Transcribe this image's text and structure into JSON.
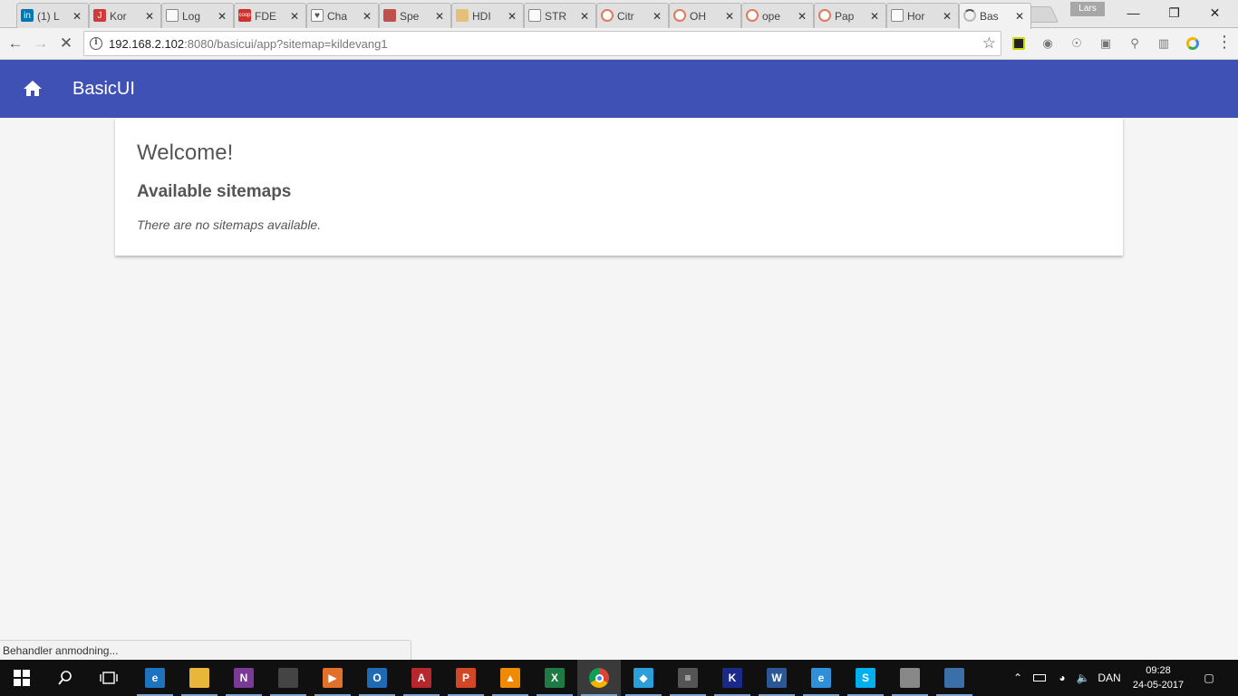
{
  "browser": {
    "tabs": [
      {
        "title": "(1) L",
        "icon": "linkedin-icon",
        "color": "#0077b5",
        "glyph": "in"
      },
      {
        "title": "Kor",
        "icon": "j-icon",
        "color": "#d03a3a",
        "glyph": "J"
      },
      {
        "title": "Log",
        "icon": "page-icon",
        "color": "",
        "glyph": ""
      },
      {
        "title": "FDE",
        "icon": "coop-icon",
        "color": "#d0312d",
        "glyph": "coop"
      },
      {
        "title": "Cha",
        "icon": "heart-icon",
        "color": "",
        "glyph": "♥"
      },
      {
        "title": "Spe",
        "icon": "gnome-icon",
        "color": "#c0504d",
        "glyph": ""
      },
      {
        "title": "HDI",
        "icon": "badge-icon",
        "color": "#e5c07b",
        "glyph": ""
      },
      {
        "title": "STR",
        "icon": "page-icon",
        "color": "",
        "glyph": ""
      },
      {
        "title": "Citr",
        "icon": "spiral-icon",
        "color": "",
        "glyph": ""
      },
      {
        "title": "OH",
        "icon": "openhab-icon",
        "color": "",
        "glyph": ""
      },
      {
        "title": "ope",
        "icon": "openhab-icon",
        "color": "",
        "glyph": ""
      },
      {
        "title": "Pap",
        "icon": "openhab-icon",
        "color": "",
        "glyph": ""
      },
      {
        "title": "Hor",
        "icon": "page-icon",
        "color": "",
        "glyph": ""
      },
      {
        "title": "Bas",
        "icon": "loading-spinner-icon",
        "color": "",
        "glyph": ""
      }
    ],
    "profile_name": "Lars",
    "url_host": "192.168.2.102",
    "url_rest": ":8080/basicui/app?sitemap=kildevang1",
    "status_text": "Behandler anmodning..."
  },
  "app": {
    "title": "BasicUI",
    "accent": "#3f51b5"
  },
  "card": {
    "welcome": "Welcome!",
    "heading": "Available sitemaps",
    "empty_message": "There are no sitemaps available."
  },
  "taskbar": {
    "apps": [
      {
        "name": "edge",
        "color": "#1e73be",
        "glyph": "e"
      },
      {
        "name": "file-explorer",
        "color": "#e8b73a",
        "glyph": ""
      },
      {
        "name": "onenote",
        "color": "#7b3a96",
        "glyph": "N"
      },
      {
        "name": "store",
        "color": "#444",
        "glyph": ""
      },
      {
        "name": "media-player",
        "color": "#e0702a",
        "glyph": "▶"
      },
      {
        "name": "outlook",
        "color": "#1e6ab3",
        "glyph": "O"
      },
      {
        "name": "access",
        "color": "#b7282e",
        "glyph": "A"
      },
      {
        "name": "powerpoint",
        "color": "#d24726",
        "glyph": "P"
      },
      {
        "name": "vlc",
        "color": "#f08a00",
        "glyph": "▲"
      },
      {
        "name": "excel",
        "color": "#1d7a44",
        "glyph": "X"
      },
      {
        "name": "chrome",
        "color": "#4285f4",
        "glyph": ""
      },
      {
        "name": "remote",
        "color": "#2b9fd9",
        "glyph": "◆"
      },
      {
        "name": "calculator",
        "color": "#555",
        "glyph": "≡"
      },
      {
        "name": "k-app",
        "color": "#1a2a8a",
        "glyph": "K"
      },
      {
        "name": "word",
        "color": "#2b5797",
        "glyph": "W"
      },
      {
        "name": "internet-explorer",
        "color": "#2f8fd8",
        "glyph": "e"
      },
      {
        "name": "skype",
        "color": "#00aff0",
        "glyph": "S"
      },
      {
        "name": "network-app",
        "color": "#888",
        "glyph": ""
      },
      {
        "name": "screen-app",
        "color": "#3a6fa8",
        "glyph": ""
      }
    ],
    "language": "DAN",
    "time": "09:28",
    "date": "24-05-2017"
  }
}
